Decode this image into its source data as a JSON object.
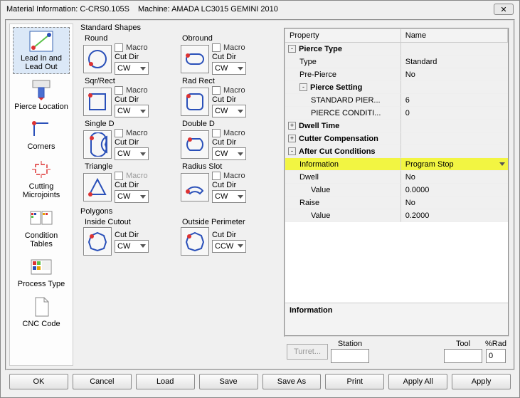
{
  "titlebar": {
    "material_label": "Material Information: C-CRS0.105S",
    "machine_label": "Machine: AMADA LC3015 GEMINI 2010"
  },
  "sidebar": {
    "items": [
      {
        "label": "Lead In and Lead Out"
      },
      {
        "label": "Pierce Location"
      },
      {
        "label": "Corners"
      },
      {
        "label": "Cutting Microjoints"
      },
      {
        "label": "Condition Tables"
      },
      {
        "label": "Process Type"
      },
      {
        "label": "CNC Code"
      }
    ]
  },
  "shapes": {
    "title": "Standard Shapes",
    "macro_label": "Macro",
    "cutdir_label": "Cut Dir",
    "items": [
      {
        "name": "Round",
        "dir": "CW",
        "macro_enabled": true
      },
      {
        "name": "Obround",
        "dir": "CW",
        "macro_enabled": true
      },
      {
        "name": "Sqr/Rect",
        "dir": "CW",
        "macro_enabled": true
      },
      {
        "name": "Rad Rect",
        "dir": "CW",
        "macro_enabled": true
      },
      {
        "name": "Single D",
        "dir": "CW",
        "macro_enabled": true
      },
      {
        "name": "Double D",
        "dir": "CW",
        "macro_enabled": true
      },
      {
        "name": "Triangle",
        "dir": "CW",
        "macro_enabled": false
      },
      {
        "name": "Radius Slot",
        "dir": "CW",
        "macro_enabled": true
      }
    ],
    "polygons_title": "Polygons",
    "polygons": [
      {
        "name": "Inside Cutout",
        "dir": "CW"
      },
      {
        "name": "Outside Perimeter",
        "dir": "CCW"
      }
    ]
  },
  "props": {
    "col_property": "Property",
    "col_name": "Name",
    "rows": [
      {
        "type": "group",
        "exp": "-",
        "label": "Pierce Type",
        "bold": true
      },
      {
        "type": "prop",
        "ind": 1,
        "label": "Type",
        "value": "Standard"
      },
      {
        "type": "prop",
        "ind": 1,
        "label": "Pre-Pierce",
        "value": "No"
      },
      {
        "type": "group",
        "exp": "-",
        "ind": 1,
        "label": "Pierce Setting",
        "bold": true
      },
      {
        "type": "prop",
        "ind": 2,
        "label": "STANDARD PIER...",
        "value": "6"
      },
      {
        "type": "prop",
        "ind": 2,
        "label": "PIERCE CONDITI...",
        "value": "0"
      },
      {
        "type": "group",
        "exp": "+",
        "label": "Dwell Time",
        "bold": true
      },
      {
        "type": "group",
        "exp": "+",
        "label": "Cutter Compensation",
        "bold": true
      },
      {
        "type": "group",
        "exp": "-",
        "label": "After Cut Conditions",
        "bold": true
      },
      {
        "type": "prop",
        "ind": 1,
        "label": "Information",
        "value": "Program Stop",
        "hl": true,
        "dd": true
      },
      {
        "type": "prop",
        "ind": 1,
        "label": "Dwell",
        "value": "No"
      },
      {
        "type": "prop",
        "ind": 2,
        "label": "Value",
        "value": "0.0000"
      },
      {
        "type": "prop",
        "ind": 1,
        "label": "Raise",
        "value": "No"
      },
      {
        "type": "prop",
        "ind": 2,
        "label": "Value",
        "value": "0.2000"
      }
    ],
    "desc_title": "Information"
  },
  "bottom": {
    "station_label": "Station",
    "tool_label": "Tool",
    "rad_label": "%Rad",
    "turret_label": "Turret...",
    "station_value": "",
    "tool_value": "",
    "rad_value": "0"
  },
  "buttons": {
    "ok": "OK",
    "cancel": "Cancel",
    "load": "Load",
    "save": "Save",
    "saveas": "Save As",
    "print": "Print",
    "applyall": "Apply All",
    "apply": "Apply"
  }
}
